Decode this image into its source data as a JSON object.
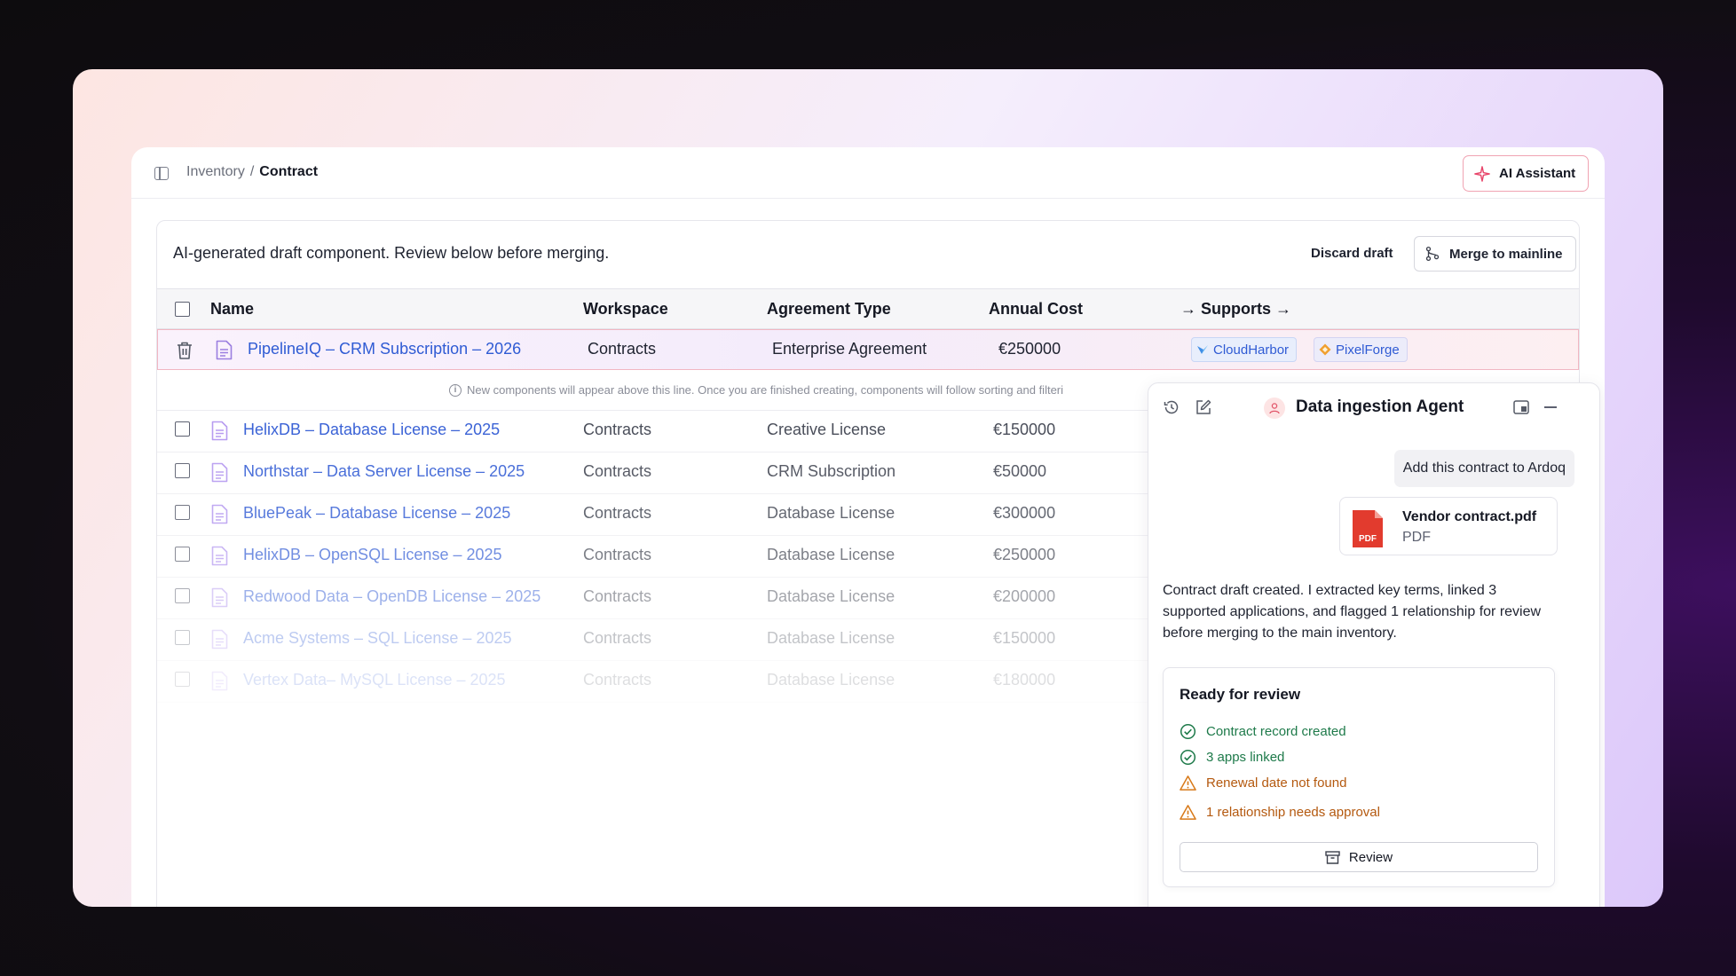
{
  "breadcrumb": {
    "parent": "Inventory",
    "separator": "/",
    "current": "Contract"
  },
  "header": {
    "ai_assistant_label": "AI Assistant"
  },
  "draft": {
    "message": "AI-generated draft component. Review below before merging.",
    "discard_label": "Discard draft",
    "merge_label": "Merge to mainline"
  },
  "table": {
    "columns": {
      "name": "Name",
      "workspace": "Workspace",
      "agreement_type": "Agreement Type",
      "annual_cost": "Annual Cost",
      "supports": "→ Supports →"
    },
    "new_row": {
      "name": "PipelineIQ – CRM Subscription – 2026",
      "workspace": "Contracts",
      "agreement_type": "Enterprise Agreement",
      "annual_cost": "€250000",
      "supports": [
        "CloudHarbor",
        "PixelForge"
      ]
    },
    "info_text": "New components will appear above this line. Once you are finished creating, components will follow sorting and filteri",
    "rows": [
      {
        "name": "HelixDB – Database License – 2025",
        "workspace": "Contracts",
        "agreement_type": "Creative License",
        "annual_cost": "€150000"
      },
      {
        "name": "Northstar – Data Server License – 2025",
        "workspace": "Contracts",
        "agreement_type": "CRM Subscription",
        "annual_cost": "€50000"
      },
      {
        "name": "BluePeak  –  Database License – 2025",
        "workspace": "Contracts",
        "agreement_type": "Database License",
        "annual_cost": "€300000"
      },
      {
        "name": "HelixDB – OpenSQL License – 2025",
        "workspace": "Contracts",
        "agreement_type": "Database License",
        "annual_cost": "€250000"
      },
      {
        "name": "Redwood Data – OpenDB License – 2025",
        "workspace": "Contracts",
        "agreement_type": "Database License",
        "annual_cost": "€200000"
      },
      {
        "name": "Acme Systems – SQL License – 2025",
        "workspace": "Contracts",
        "agreement_type": "Database License",
        "annual_cost": "€150000"
      },
      {
        "name": "Vertex Data– MySQL License – 2025",
        "workspace": "Contracts",
        "agreement_type": "Database License",
        "annual_cost": "€180000"
      }
    ]
  },
  "agent": {
    "title": "Data ingestion Agent",
    "user_message": "Add this contract to Ardoq",
    "file": {
      "name": "Vendor contract.pdf",
      "type": "PDF",
      "badge": "PDF"
    },
    "reply": "Contract draft created. I extracted key terms, linked 3 supported applications, and flagged 1 relationship for review before merging to the main inventory.",
    "review": {
      "title": "Ready for review",
      "items": [
        {
          "label": "Contract record created",
          "status": "ok"
        },
        {
          "label": "3 apps linked",
          "status": "ok"
        },
        {
          "label": "Renewal date not found",
          "status": "warn"
        },
        {
          "label": "1 relationship needs approval",
          "status": "warn"
        }
      ],
      "button_label": "Review"
    }
  },
  "colors": {
    "accent_link": "#2f5bd4",
    "ok": "#1e7a4a",
    "warn": "#b4590f",
    "highlight_border": "#f1b6c2"
  }
}
